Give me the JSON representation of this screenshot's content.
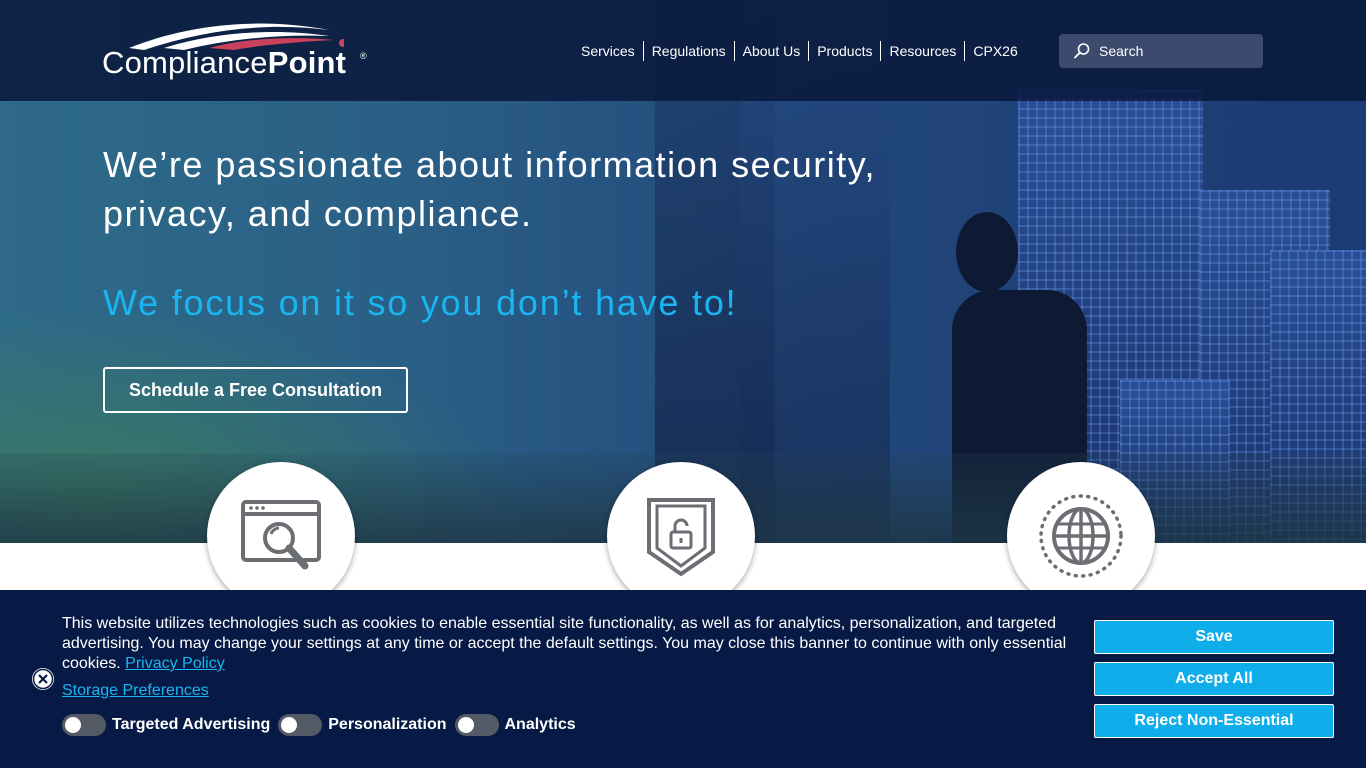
{
  "brand": {
    "logo_text_light": "Compliance",
    "logo_text_bold": "Point",
    "logo_reg": "®",
    "accent": "#19b5f0",
    "logo_swoosh_red": "#c9415a"
  },
  "nav": {
    "items": [
      "Services",
      "Regulations",
      "About Us",
      "Products",
      "Resources",
      "CPX26"
    ]
  },
  "search": {
    "placeholder": "Search",
    "icon": "search-icon"
  },
  "hero": {
    "headline": "We’re passionate about information security, privacy, and compliance.",
    "subhead": "We focus on it so you don’t have to!",
    "cta_label": "Schedule a Free Consultation"
  },
  "features": {
    "icons": [
      "browser-magnifier-icon",
      "shield-unlock-icon",
      "globe-icon"
    ]
  },
  "cookie_banner": {
    "text": "This website utilizes technologies such as cookies to enable essential site functionality, as well as for analytics, personalization, and targeted advertising. You may change your settings at any time or accept the default settings. You may close this banner to continue with only essential cookies. ",
    "privacy_link": "Privacy Policy",
    "storage_link": "Storage Preferences",
    "toggles": [
      {
        "label": "Targeted Advertising",
        "on": false
      },
      {
        "label": "Personalization",
        "on": false
      },
      {
        "label": "Analytics",
        "on": false
      }
    ],
    "buttons": {
      "save": "Save",
      "accept_all": "Accept All",
      "reject": "Reject Non-Essential"
    },
    "close_icon": "close-icon"
  }
}
